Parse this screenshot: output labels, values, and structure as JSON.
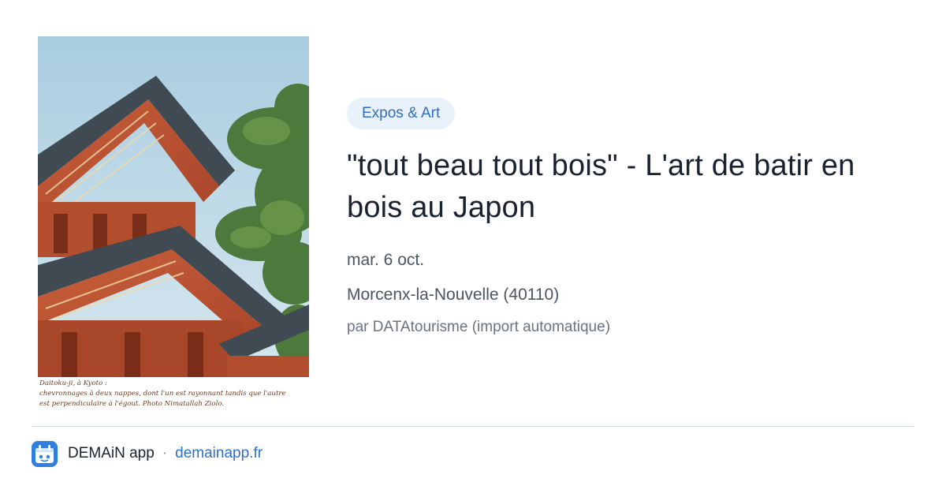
{
  "card": {
    "image": {
      "description_icon": "pagoda-photo",
      "caption_lines": [
        "Daitoku-ji, à Kyoto :",
        "chevronnages à deux nappes, dont l'un est rayonnant tandis que l'autre",
        "est perpendiculaire à l'égout. Photo Nimatallah Ziolo."
      ]
    },
    "category_tag": "Expos & Art",
    "title": "\"tout beau tout bois\" - L'art de batir en bois au Japon",
    "date": "mar. 6 oct.",
    "location": "Morcenx-la-Nouvelle (40110)",
    "author": "par DATAtourisme (import automatique)"
  },
  "footer": {
    "app_icon": "demain-app-icon",
    "app_name": "DEMAiN app",
    "separator": "·",
    "link_text": "demainapp.fr"
  },
  "colors": {
    "tag_bg": "#e9f1fb",
    "tag_text": "#2f6fc6",
    "title": "#1a2230",
    "meta": "#4b5563",
    "link": "#2f6fc6",
    "brand": "#2f7ee0"
  }
}
